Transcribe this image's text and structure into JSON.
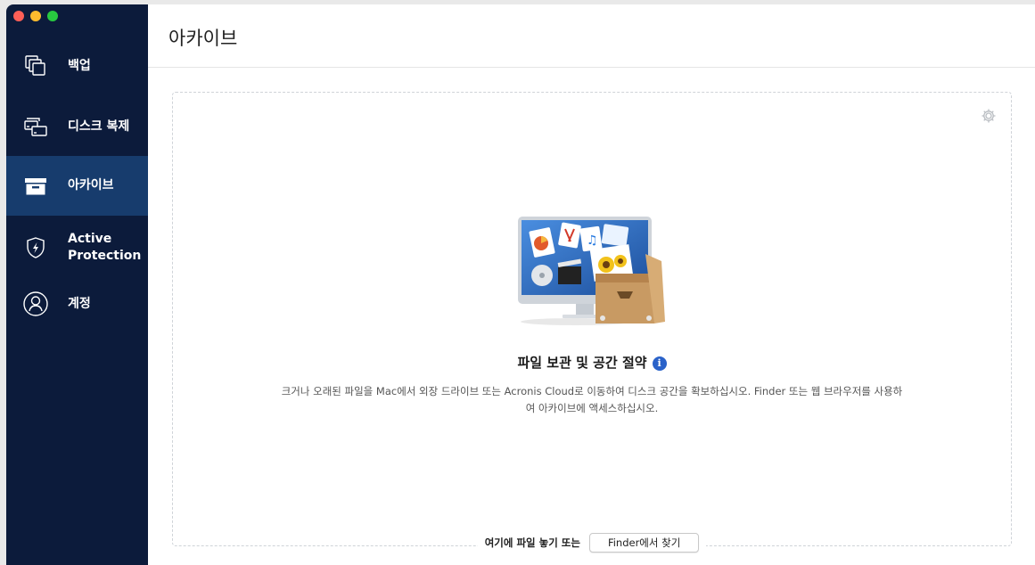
{
  "window": {
    "traffic_lights": [
      "close",
      "minimize",
      "zoom"
    ]
  },
  "sidebar": {
    "items": [
      {
        "label": "백업",
        "icon": "backup-copies-icon"
      },
      {
        "label": "디스크 복제",
        "icon": "disk-clone-icon"
      },
      {
        "label": "아카이브",
        "icon": "archive-box-icon",
        "active": true
      },
      {
        "label": "Active Protection",
        "icon": "shield-bolt-icon"
      },
      {
        "label": "계정",
        "icon": "account-user-icon"
      }
    ]
  },
  "header": {
    "title": "아카이브"
  },
  "main": {
    "headline": "파일 보관 및 공간 절약",
    "info_icon": "i",
    "description": "크거나 오래된 파일을 Mac에서 외장 드라이브 또는 Acronis Cloud로 이동하여 디스크 공간을 확보하십시오. Finder 또는 웹 브라우저를 사용하여 아카이브에 액세스하십시오.",
    "drop_text": "여기에 파일 놓기 또는",
    "finder_button": "Finder에서 찾기"
  },
  "colors": {
    "sidebar_bg": "#0c1b3b",
    "sidebar_active_bg": "#173c6d",
    "accent": "#2a62c9"
  }
}
